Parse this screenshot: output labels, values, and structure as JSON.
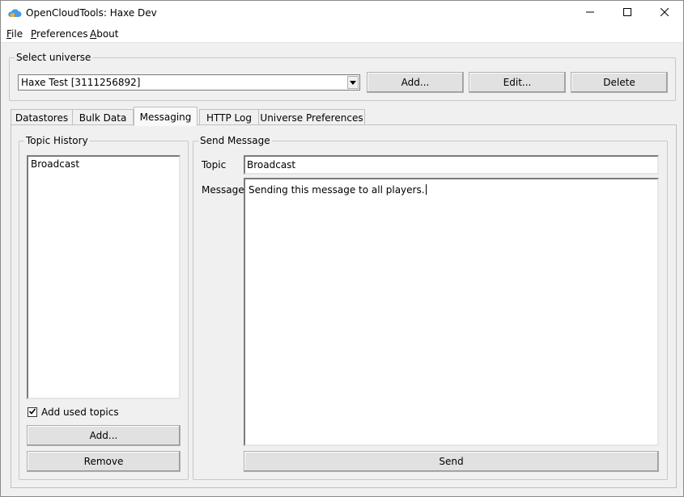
{
  "window": {
    "title": "OpenCloudTools: Haxe Dev",
    "controls": {
      "minimize": "minimize-icon",
      "maximize": "maximize-icon",
      "close": "close-icon"
    }
  },
  "menu": {
    "file": {
      "key": "F",
      "rest": "ile"
    },
    "preferences": {
      "key": "P",
      "rest": "references"
    },
    "about": {
      "key": "A",
      "rest": "bout"
    }
  },
  "universe": {
    "group_label": "Select universe",
    "selected": "Haxe Test [3111256892]",
    "add_label": "Add...",
    "edit_label": "Edit...",
    "delete_label": "Delete"
  },
  "tabs": [
    {
      "label": "Datastores",
      "active": false
    },
    {
      "label": "Bulk Data",
      "active": false
    },
    {
      "label": "Messaging",
      "active": true
    },
    {
      "label": "HTTP Log",
      "active": false
    },
    {
      "label": "Universe Preferences",
      "active": false
    }
  ],
  "topic_history": {
    "group_label": "Topic History",
    "items": [
      "Broadcast"
    ],
    "add_used_topics_label": "Add used topics",
    "add_used_topics_checked": true,
    "add_label": "Add...",
    "remove_label": "Remove"
  },
  "send_message": {
    "group_label": "Send Message",
    "topic_label": "Topic",
    "topic_value": "Broadcast",
    "message_label": "Message",
    "message_value": "Sending this message to all players.",
    "send_label": "Send"
  }
}
